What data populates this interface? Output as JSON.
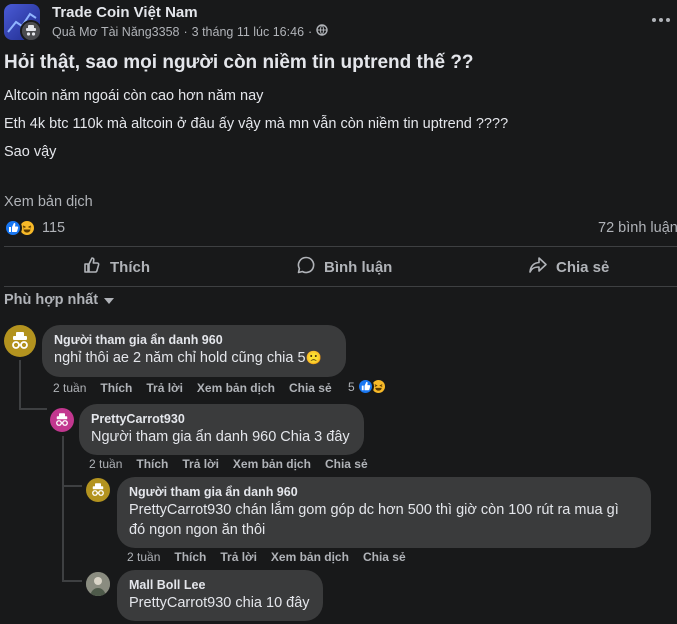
{
  "post": {
    "group_name": "Trade Coin Việt Nam",
    "author": "Quả Mơ Tài Năng3358",
    "timestamp": "3 tháng 11 lúc 16:46",
    "title": "Hỏi thật, sao mọi người còn niềm tin uptrend thế ??",
    "lines": [
      "Altcoin năm ngoái còn cao hơn năm nay",
      "Eth 4k btc 110k mà altcoin ở đâu ấy vậy mà mn vẫn còn niềm tin uptrend ????",
      "Sao vậy"
    ],
    "see_translation": "Xem bản dịch",
    "reaction_count": "115",
    "comment_count": "72 bình luận"
  },
  "actions": {
    "like": "Thích",
    "comment": "Bình luận",
    "share": "Chia sẻ"
  },
  "sort_label": "Phù hợp nhất",
  "comments": [
    {
      "name": "Người tham gia ẩn danh 960",
      "text": "nghỉ thôi ae 2 năm chỉ hold cũng chia 5",
      "emoji": "🙁",
      "time": "2 tuần",
      "like": "Thích",
      "reply": "Trả lời",
      "translate": "Xem bản dịch",
      "share": "Chia sẻ",
      "reactions": "5"
    },
    {
      "name": "PrettyCarrot930",
      "text": "Người tham gia ẩn danh 960 Chia 3 đây",
      "time": "2 tuần",
      "like": "Thích",
      "reply": "Trả lời",
      "translate": "Xem bản dịch",
      "share": "Chia sẻ"
    },
    {
      "name": "Người tham gia ẩn danh 960",
      "text_line1": "PrettyCarrot930 chán lắm gom góp dc hơn 500 thì giờ còn 100 rút ra mua gì",
      "text_line2": "đó ngon ngon ăn thôi",
      "time": "2 tuần",
      "like": "Thích",
      "reply": "Trả lời",
      "translate": "Xem bản dịch",
      "share": "Chia sẻ"
    },
    {
      "name": "Mall Boll Lee",
      "text": "PrettyCarrot930 chia 10 đây"
    }
  ],
  "colors": {
    "background": "#18191a",
    "bubble": "#3a3b3c",
    "text": "#e4e6eb",
    "muted": "#b0b3b8",
    "like_blue": "#1877f2",
    "haha_yellow": "#f7b928"
  }
}
